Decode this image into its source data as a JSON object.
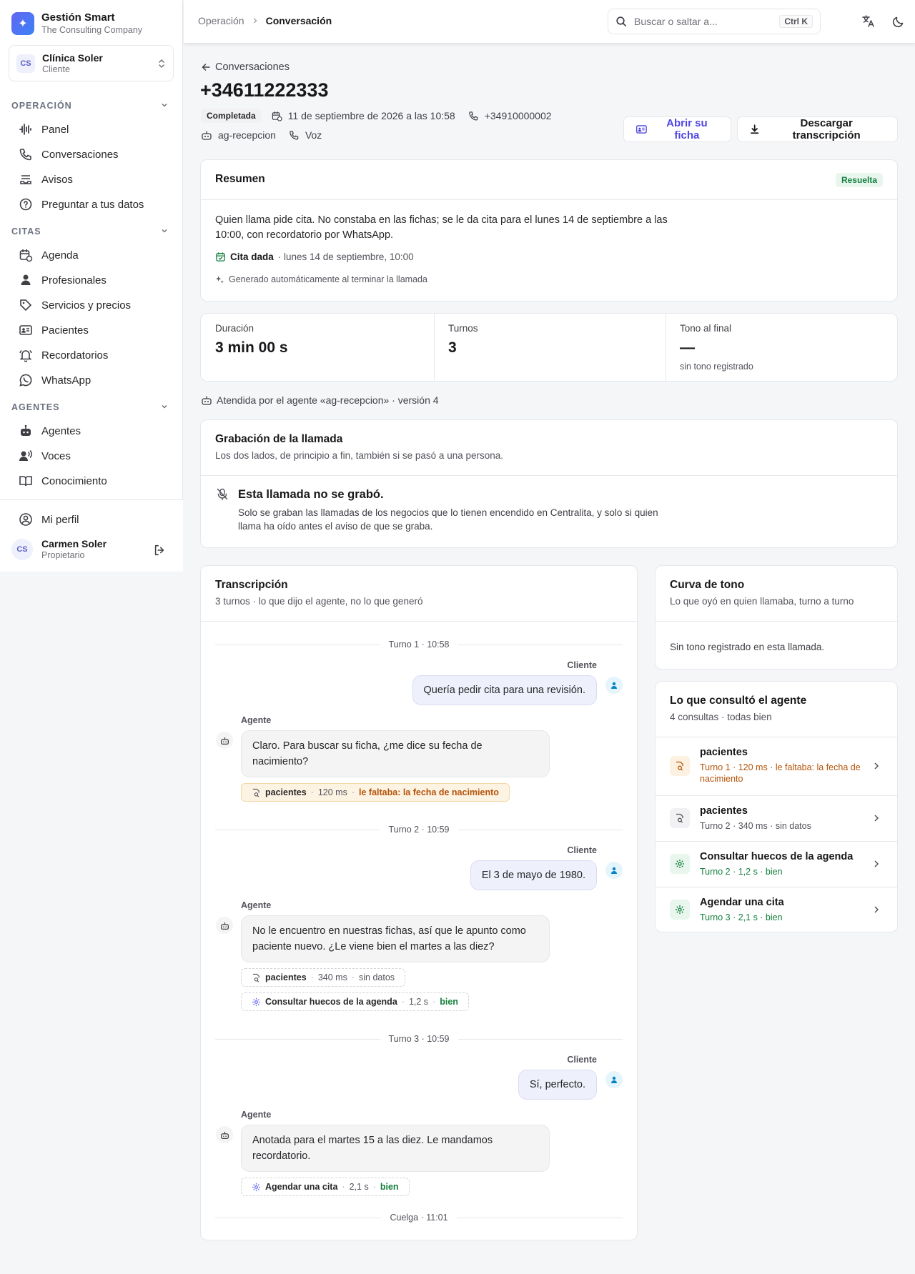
{
  "sidebar": {
    "brand_name": "Gestión Smart",
    "brand_sub": "The Consulting Company",
    "org_initials": "CS",
    "org_name": "Clínica Soler",
    "org_role": "Cliente",
    "sections": {
      "operacion": "OPERACIÓN",
      "citas": "CITAS",
      "agentes": "AGENTES"
    },
    "items": {
      "panel": "Panel",
      "conversaciones": "Conversaciones",
      "avisos": "Avisos",
      "preguntar": "Preguntar a tus datos",
      "agenda": "Agenda",
      "profesionales": "Profesionales",
      "servicios": "Servicios y precios",
      "pacientes": "Pacientes",
      "recordatorios": "Recordatorios",
      "whatsapp": "WhatsApp",
      "agentes": "Agentes",
      "voces": "Voces",
      "conocimiento": "Conocimiento"
    },
    "profile": "Mi perfil",
    "user_initials": "CS",
    "user_name": "Carmen Soler",
    "user_role": "Propietario"
  },
  "topbar": {
    "crumb_1": "Operación",
    "crumb_2": "Conversación",
    "search_placeholder": "Buscar o saltar a...",
    "search_shortcut": "Ctrl K"
  },
  "call": {
    "back": "Conversaciones",
    "phone": "+34611222333",
    "status": "Completada",
    "datetime": "11 de septiembre de 2026 a las 10:58",
    "to_number": "+34910000002",
    "agent": "ag-recepcion",
    "channel": "Voz",
    "btn_ficha": "Abrir su ficha",
    "btn_download": "Descargar transcripción"
  },
  "summary": {
    "title": "Resumen",
    "badge": "Resuelta",
    "text": "Quien llama pide cita. No constaba en las fichas; se le da cita para el lunes 14 de septiembre a las 10:00, con recordatorio por WhatsApp.",
    "cita_label": "Cita dada",
    "cita_detail": "· lunes 14 de septiembre, 10:00",
    "generated": "Generado automáticamente al terminar la llamada"
  },
  "stats": {
    "duration_label": "Duración",
    "duration_value": "3 min 00 s",
    "turns_label": "Turnos",
    "turns_value": "3",
    "tone_label": "Tono al final",
    "tone_value": "—",
    "tone_sub": "sin tono registrado"
  },
  "agent_line": "Atendida por el agente «ag-recepcion» · versión 4",
  "recording": {
    "title": "Grabación de la llamada",
    "sub": "Los dos lados, de principio a fin, también si se pasó a una persona.",
    "none_title": "Esta llamada no se grabó.",
    "none_text": "Solo se graban las llamadas de los negocios que lo tienen encendido en Centralita, y solo si quien llama ha oído antes el aviso de que se graba."
  },
  "transcript": {
    "title": "Transcripción",
    "sub": "3 turnos · lo que dijo el agente, no lo que generó",
    "client_label": "Cliente",
    "agent_label": "Agente",
    "turns": [
      {
        "sep": "Turno 1 · 10:58",
        "client": "Quería pedir cita para una revisión.",
        "agent": "Claro. Para buscar su ficha, ¿me dice su fecha de nacimiento?",
        "tools": [
          {
            "name": "pacientes",
            "time": "120 ms",
            "result": "le faltaba: la fecha de nacimiento"
          }
        ]
      },
      {
        "sep": "Turno 2 · 10:59",
        "client": "El 3 de mayo de 1980.",
        "agent": "No le encuentro en nuestras fichas, así que le apunto como paciente nuevo. ¿Le viene bien el martes a las diez?",
        "tools": [
          {
            "name": "pacientes",
            "time": "340 ms",
            "result": "sin datos"
          },
          {
            "name": "Consultar huecos de la agenda",
            "time": "1,2 s",
            "result": "bien"
          }
        ]
      },
      {
        "sep": "Turno 3 · 10:59",
        "client": "Sí, perfecto.",
        "agent": "Anotada para el martes 15 a las diez. Le mandamos recordatorio.",
        "tools": [
          {
            "name": "Agendar una cita",
            "time": "2,1 s",
            "result": "bien"
          }
        ]
      }
    ],
    "end": "Cuelga · 11:01"
  },
  "tone_curve": {
    "title": "Curva de tono",
    "sub": "Lo que oyó en quien llamaba, turno a turno",
    "empty": "Sin tono registrado en esta llamada."
  },
  "consults": {
    "title": "Lo que consultó el agente",
    "sub": "4 consultas · todas bien",
    "items": [
      {
        "name": "pacientes",
        "detail": "Turno 1 · 120 ms · le faltaba: la fecha de nacimiento"
      },
      {
        "name": "pacientes",
        "detail": "Turno 2 · 340 ms · sin datos"
      },
      {
        "name": "Consultar huecos de la agenda",
        "detail": "Turno 2 · 1,2 s · bien"
      },
      {
        "name": "Agendar una cita",
        "detail": "Turno 3 · 2,1 s · bien"
      }
    ]
  },
  "colors": {
    "accent": "#5b5fc7",
    "success": "#15803d",
    "warning": "#b45309"
  }
}
